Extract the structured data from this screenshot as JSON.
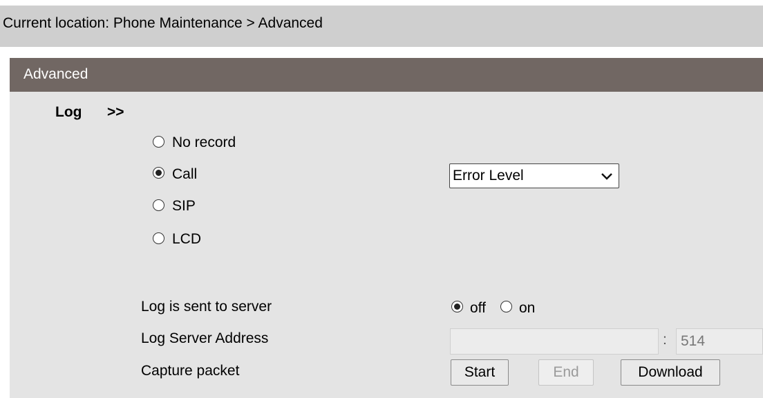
{
  "location": {
    "prefix": "Current location: ",
    "path": "Phone Maintenance > Advanced"
  },
  "panel": {
    "title": "Advanced"
  },
  "log": {
    "label": "Log",
    "arrows": ">>",
    "options": [
      {
        "label": "No record",
        "checked": false
      },
      {
        "label": "Call",
        "checked": true
      },
      {
        "label": "SIP",
        "checked": false
      },
      {
        "label": "LCD",
        "checked": false
      }
    ],
    "level_select": {
      "value": "Error Level"
    }
  },
  "server": {
    "sent_label": "Log is sent to server",
    "off_label": "off",
    "on_label": "on",
    "off_checked": true,
    "address_label": "Log Server Address",
    "address_value": "",
    "separator": ":",
    "port_value": "514"
  },
  "capture": {
    "label": "Capture packet",
    "start": "Start",
    "end": "End",
    "download": "Download"
  }
}
